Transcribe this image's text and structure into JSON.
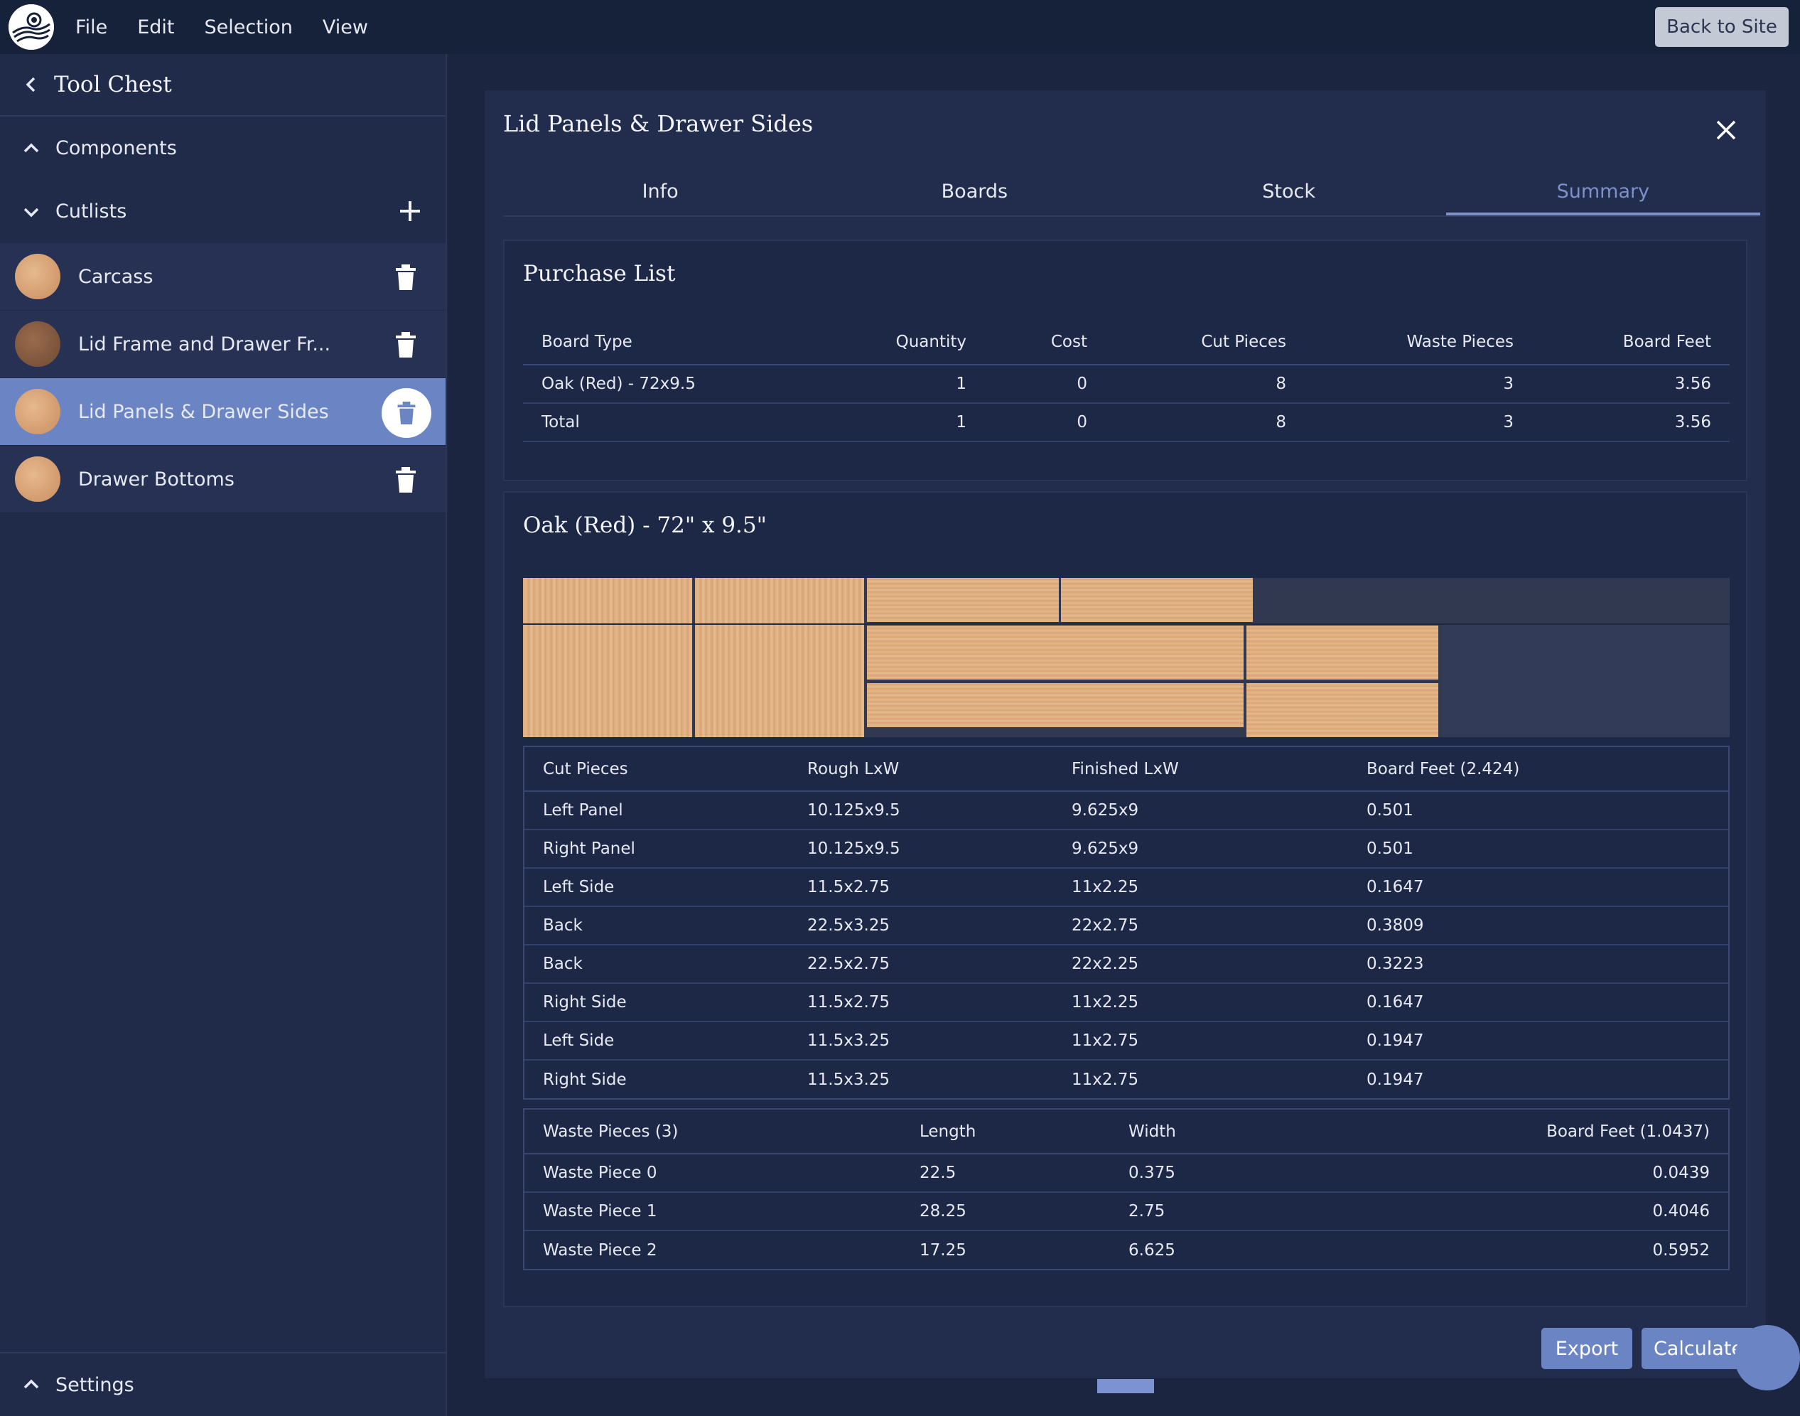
{
  "menubar": {
    "items": [
      "File",
      "Edit",
      "Selection",
      "View"
    ],
    "back_button": "Back to Site"
  },
  "sidebar": {
    "title": "Tool Chest",
    "sections": {
      "components": "Components",
      "cutlists": "Cutlists",
      "settings": "Settings"
    },
    "cutlists": [
      {
        "label": "Carcass"
      },
      {
        "label": "Lid Frame and Drawer Fr..."
      },
      {
        "label": "Lid Panels & Drawer Sides"
      },
      {
        "label": "Drawer Bottoms"
      }
    ]
  },
  "dialog": {
    "title": "Lid Panels & Drawer Sides",
    "tabs": [
      "Info",
      "Boards",
      "Stock",
      "Summary"
    ],
    "active_tab": "Summary",
    "purchase": {
      "title": "Purchase List",
      "headers": [
        "Board Type",
        "Quantity",
        "Cost",
        "Cut Pieces",
        "Waste Pieces",
        "Board Feet"
      ],
      "rows": [
        [
          "Oak (Red) - 72x9.5",
          "1",
          "0",
          "8",
          "3",
          "3.56"
        ],
        [
          "Total",
          "1",
          "0",
          "8",
          "3",
          "3.56"
        ]
      ]
    },
    "board": {
      "title": "Oak (Red) - 72\" x 9.5\"",
      "cut_headers": [
        "Cut Pieces",
        "Rough LxW",
        "Finished LxW",
        "Board Feet (2.424)"
      ],
      "cut_rows": [
        [
          "Left Panel",
          "10.125x9.5",
          "9.625x9",
          "0.501"
        ],
        [
          "Right Panel",
          "10.125x9.5",
          "9.625x9",
          "0.501"
        ],
        [
          "Left Side",
          "11.5x2.75",
          "11x2.25",
          "0.1647"
        ],
        [
          "Back",
          "22.5x3.25",
          "22x2.75",
          "0.3809"
        ],
        [
          "Back",
          "22.5x2.75",
          "22x2.25",
          "0.3223"
        ],
        [
          "Right Side",
          "11.5x2.75",
          "11x2.25",
          "0.1647"
        ],
        [
          "Left Side",
          "11.5x3.25",
          "11x2.75",
          "0.1947"
        ],
        [
          "Right Side",
          "11.5x3.25",
          "11x2.75",
          "0.1947"
        ]
      ],
      "waste_headers": [
        "Waste Pieces (3)",
        "Length",
        "Width",
        "Board Feet (1.0437)"
      ],
      "waste_rows": [
        [
          "Waste Piece 0",
          "22.5",
          "0.375",
          "0.0439"
        ],
        [
          "Waste Piece 1",
          "28.25",
          "2.75",
          "0.4046"
        ],
        [
          "Waste Piece 2",
          "17.25",
          "6.625",
          "0.5952"
        ]
      ]
    },
    "buttons": {
      "export": "Export",
      "calculate": "Calculate"
    }
  },
  "colors": {
    "accent": "#6b84c4",
    "bg": "#1e2744",
    "wood": "#dcaa7a"
  }
}
